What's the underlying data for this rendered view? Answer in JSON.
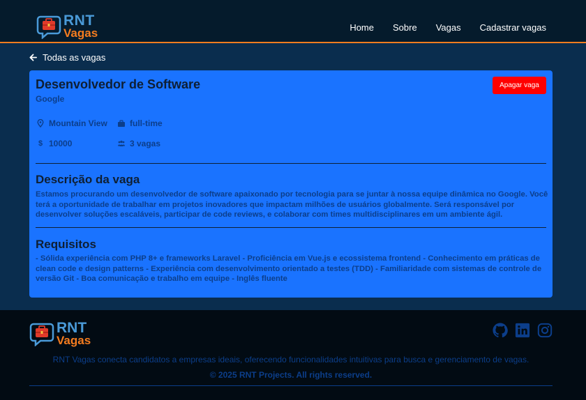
{
  "brand": {
    "name": "RNT",
    "sub": "Vagas"
  },
  "nav": {
    "items": [
      "Home",
      "Sobre",
      "Vagas",
      "Cadastrar vagas"
    ]
  },
  "back_link": "Todas as vagas",
  "job": {
    "title": "Desenvolvedor de Software",
    "company": "Google",
    "delete_label": "Apagar vaga",
    "location": "Mountain View",
    "type": "full-time",
    "salary": "10000",
    "openings": "3 vagas",
    "description_title": "Descrição da vaga",
    "description": "Estamos procurando um desenvolvedor de software apaixonado por tecnologia para se juntar à nossa equipe dinâmica no Google. Você terá a oportunidade de trabalhar em projetos inovadores que impactam milhões de usuários globalmente. Será responsável por desenvolver soluções escaláveis, participar de code reviews, e colaborar com times multidisciplinares em um ambiente ágil.",
    "requirements_title": "Requisitos",
    "requirements": "- Sólida experiência com PHP 8+ e frameworks Laravel - Proficiência em Vue.js e ecossistema frontend - Conhecimento em práticas de clean code e design patterns - Experiência com desenvolvimento orientado a testes (TDD) - Familiaridade com sistemas de controle de versão Git - Boa comunicação e trabalho em equipe - Inglês fluente"
  },
  "footer": {
    "description": "RNT Vagas conecta candidatos a empresas ideais, oferecendo funcionalidades intuitivas para busca e gerenciamento de vagas.",
    "copyright": "© 2025 RNT Projects. All rights reserved.",
    "social_icons": [
      "github-icon",
      "linkedin-icon",
      "instagram-icon"
    ]
  },
  "colors": {
    "header_bg": "#051b2c",
    "accent_orange": "#f57c1f",
    "card_bg": "#1a73ff",
    "danger": "#ff0000",
    "footer_bg": "#020b13"
  }
}
